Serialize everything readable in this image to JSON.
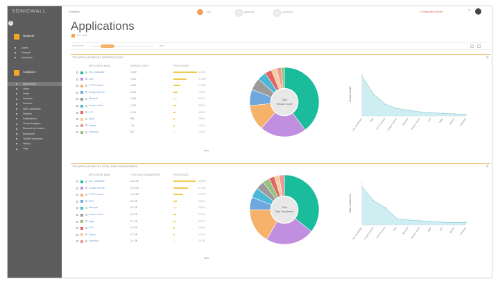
{
  "sidebar": {
    "logo": "SONICWALL",
    "section1": {
      "label": "Network"
    },
    "items1": [
      "Users",
      "Firewall",
      "Interfaces"
    ],
    "section2": {
      "label": "Analytics"
    },
    "items2": [
      "Applications",
      "Users",
      "Hosts",
      "Intrusion",
      "Sources",
      "Web Categories",
      "Devices",
      "Destinations",
      "Threat Analytics",
      "Blocked by Content",
      "Bandwidth",
      "Threat Prevention",
      "History",
      "Logs"
    ],
    "active_index": 0
  },
  "topbar": {
    "crumb": "Analytics",
    "toggles": [
      {
        "label": "LIVE",
        "color": "#f5a05a"
      },
      {
        "label": "REPORT",
        "color": "#eeeeee"
      },
      {
        "label": "HISTORY",
        "color": "#eeeeee"
      }
    ],
    "alert": "Configuration Mode",
    "help": "?"
  },
  "page": {
    "title": "Applications",
    "subtitle": "Live Data"
  },
  "timebar": {
    "left": "Last 60 min",
    "mid": "00:30",
    "right": "Now"
  },
  "panels": [
    {
      "heading": "TOP APPLICATIONS BY SESSION COUNT",
      "col_app": "APPLICATION NAME",
      "col_val": "SESSION COUNT",
      "col_pct": "PERCENTAGE",
      "more": "More",
      "donut_inner": [
        "Total",
        "Session Count"
      ],
      "ylabel": "Session Count",
      "rows": [
        {
          "name": "SSL Handshake",
          "value": "13,807",
          "pct": "38.14%",
          "color": "#1abc9c",
          "fill": 0.38
        },
        {
          "name": "DNS",
          "value": "7,522",
          "pct": "20.78%",
          "color": "#c08fe0",
          "fill": 0.21
        },
        {
          "name": "HTTP Protocol",
          "value": "4,105",
          "pct": "11.34%",
          "color": "#f6b26b",
          "fill": 0.11
        },
        {
          "name": "Google General",
          "value": "2,614",
          "pct": "7.22%",
          "color": "#6fa8dc",
          "fill": 0.07
        },
        {
          "name": "Microsoft",
          "value": "1,980",
          "pct": "5.47%",
          "color": "#9b9b9b",
          "fill": 0.05
        },
        {
          "name": "Amazon Cloud",
          "value": "1,422",
          "pct": "3.93%",
          "color": "#4ab8d6",
          "fill": 0.04
        },
        {
          "name": "NTP",
          "value": "1,105",
          "pct": "3.05%",
          "color": "#e06666",
          "fill": 0.03
        },
        {
          "name": "Apple",
          "value": "906",
          "pct": "2.50%",
          "color": "#f9cb9c",
          "fill": 0.025
        },
        {
          "name": "Akamai",
          "value": "714",
          "pct": "1.97%",
          "color": "#ea9999",
          "fill": 0.02
        },
        {
          "name": "Facebook",
          "value": "522",
          "pct": "1.44%",
          "color": "#93c47d",
          "fill": 0.015
        }
      ]
    },
    {
      "heading": "TOP APPLICATIONS BY TOTAL DATA TRANSFERRED",
      "col_app": "APPLICATION NAME",
      "col_val": "TOTAL DATA TRANSFERRED",
      "col_pct": "PERCENTAGE",
      "more": "More",
      "donut_inner": [
        "Total",
        "Data Transferred"
      ],
      "ylabel": "Data Transferred",
      "rows": [
        {
          "name": "SSL Handshake",
          "value": "35.2 GB",
          "pct": "35.80%",
          "color": "#1abc9c",
          "fill": 0.36
        },
        {
          "name": "Google General",
          "value": "22.4 GB",
          "pct": "22.78%",
          "color": "#c08fe0",
          "fill": 0.23
        },
        {
          "name": "HTTP Protocol",
          "value": "16.1 GB",
          "pct": "16.37%",
          "color": "#f6b26b",
          "fill": 0.16
        },
        {
          "name": "DNS",
          "value": "5.8 GB",
          "pct": "5.90%",
          "color": "#6fa8dc",
          "fill": 0.06
        },
        {
          "name": "Microsoft",
          "value": "4.6 GB",
          "pct": "4.68%",
          "color": "#4ab8d6",
          "fill": 0.05
        },
        {
          "name": "Amazon Cloud",
          "value": "3.9 GB",
          "pct": "3.97%",
          "color": "#9b9b9b",
          "fill": 0.04
        },
        {
          "name": "Apple",
          "value": "3.1 GB",
          "pct": "3.15%",
          "color": "#93c47d",
          "fill": 0.03
        },
        {
          "name": "NTP",
          "value": "2.6 GB",
          "pct": "2.64%",
          "color": "#e06666",
          "fill": 0.026
        },
        {
          "name": "Akamai",
          "value": "2.2 GB",
          "pct": "2.24%",
          "color": "#f9cb9c",
          "fill": 0.022
        },
        {
          "name": "Facebook",
          "value": "2.4 GB",
          "pct": "2.47%",
          "color": "#ea9999",
          "fill": 0.024
        }
      ]
    }
  ],
  "chart_data": [
    {
      "type": "pie",
      "categories": [
        "SSL Handshake",
        "DNS",
        "HTTP Protocol",
        "Google General",
        "Microsoft",
        "Amazon Cloud",
        "NTP",
        "Apple",
        "Akamai",
        "Facebook"
      ],
      "values": [
        38.14,
        20.78,
        11.34,
        7.22,
        5.47,
        3.93,
        3.05,
        2.5,
        1.97,
        1.44
      ],
      "colors": [
        "#1abc9c",
        "#c08fe0",
        "#f6b26b",
        "#6fa8dc",
        "#9b9b9b",
        "#4ab8d6",
        "#e06666",
        "#f9cb9c",
        "#ea9999",
        "#93c47d"
      ]
    },
    {
      "type": "area",
      "x": [
        "SSL Handshake",
        "DNS",
        "HTTP Protocol",
        "Google General",
        "Microsoft",
        "Amazon Cloud",
        "NTP",
        "Apple",
        "Akamai",
        "Facebook"
      ],
      "values": [
        13807,
        7522,
        4105,
        2614,
        1980,
        1422,
        1105,
        906,
        714,
        522
      ],
      "ylim": [
        0,
        15000
      ],
      "ylabel": "Session Count"
    },
    {
      "type": "pie",
      "categories": [
        "SSL Handshake",
        "Google General",
        "HTTP Protocol",
        "DNS",
        "Microsoft",
        "Amazon Cloud",
        "Apple",
        "NTP",
        "Akamai",
        "Facebook"
      ],
      "values": [
        35.8,
        22.78,
        16.37,
        5.9,
        4.68,
        3.97,
        3.15,
        2.64,
        2.24,
        2.47
      ],
      "colors": [
        "#1abc9c",
        "#c08fe0",
        "#f6b26b",
        "#6fa8dc",
        "#4ab8d6",
        "#9b9b9b",
        "#93c47d",
        "#e06666",
        "#f9cb9c",
        "#ea9999"
      ]
    },
    {
      "type": "area",
      "x": [
        "SSL Handshake",
        "Google General",
        "HTTP Protocol",
        "DNS",
        "Microsoft",
        "Amazon Cloud",
        "Apple",
        "NTP",
        "Akamai",
        "Facebook"
      ],
      "values": [
        35.2,
        22.4,
        16.1,
        5.8,
        4.6,
        3.9,
        3.1,
        2.6,
        2.2,
        2.4
      ],
      "ylim": [
        0,
        40
      ],
      "ylabel": "Data Transferred"
    }
  ]
}
